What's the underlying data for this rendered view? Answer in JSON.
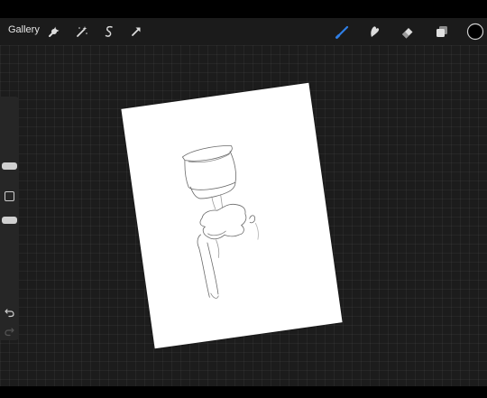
{
  "toolbar": {
    "gallery_label": "Gallery",
    "left_icons": [
      "wrench-icon",
      "magic-wand-icon",
      "selection-icon",
      "transform-arrow-icon"
    ],
    "right_icons": [
      "brush-icon",
      "smudge-icon",
      "eraser-icon",
      "layers-icon",
      "color-swatch-icon"
    ],
    "active_tool": "brush-icon",
    "active_tool_color": "#2f7fe6",
    "current_color": "#000000"
  },
  "sidebar": {
    "brush_size_level": 0.3,
    "opacity_level": 0.5,
    "undo_icon": "undo-icon",
    "redo_icon": "redo-icon",
    "modify_icon": "square-modify-icon"
  },
  "canvas": {
    "background_color": "#1c1c1c",
    "paper_color": "#ffffff"
  }
}
